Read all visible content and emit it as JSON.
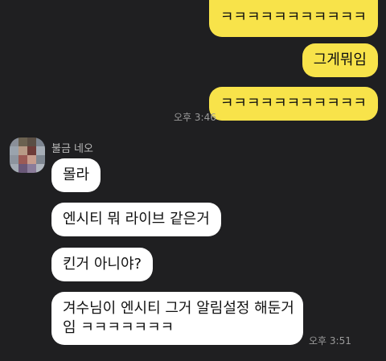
{
  "messages_sent": [
    {
      "text": "ㅋㅋㅋㅋㅋㅋㅋㅋㅋㅋㅋ"
    },
    {
      "text": "그게뭐임"
    },
    {
      "text": "ㅋㅋㅋㅋㅋㅋㅋㅋㅋㅋㅋ",
      "time": "오후 3:46"
    }
  ],
  "contact": {
    "name": "불금 네오",
    "avatar_icon": "pixelated-profile-avatar-icon"
  },
  "messages_received": [
    {
      "text": "몰라"
    },
    {
      "text": "엔시티 뭐 라이브 같은거"
    },
    {
      "text": "킨거 아니야?"
    },
    {
      "line1": "겨수님이 엔시티 그거 알림설정 해둔거",
      "line2": "임 ㅋㅋㅋㅋㅋㅋㅋ",
      "time": "오후 3:51"
    }
  ],
  "colors": {
    "background": "#1f1f21",
    "sent_bubble": "#f8e34a",
    "received_bubble": "#ffffff"
  }
}
